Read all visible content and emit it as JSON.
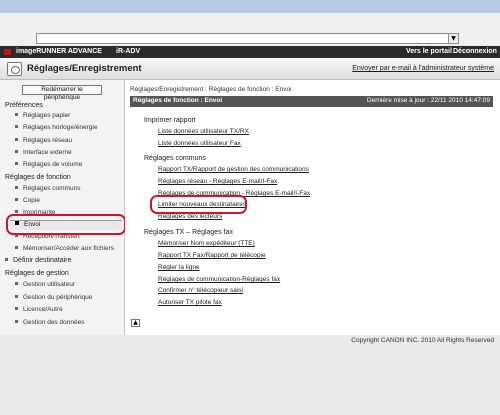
{
  "browser": {
    "address_dropdown": "▼"
  },
  "topbar": {
    "brand": "imageRUNNER ADVANCE",
    "model": "iR-ADV",
    "portal_link": "Vers le portail",
    "logout_link": "Déconnexion"
  },
  "titlebar": {
    "title": "Réglages/Enregistrement",
    "email_link": "Envoyer par e-mail à l'administrateur système"
  },
  "sidebar": {
    "restart_button": "Redémarrer le périphérique",
    "sections": [
      {
        "label": "Préférences",
        "items": [
          "Réglages papier",
          "Réglages horloge/énergie",
          "Réglages réseau",
          "Interface externe",
          "Réglages de volume"
        ]
      },
      {
        "label": "Réglages de fonction",
        "items": [
          "Réglages communs",
          "Copie",
          "Imprimante",
          "Envoi",
          "Réception/Transfert",
          "Mémoriser/Accéder aux fichiers"
        ]
      },
      {
        "label": "Définir destinataire",
        "items": []
      },
      {
        "label": "Réglages de gestion",
        "items": [
          "Gestion utilisateur",
          "Gestion du périphérique",
          "Licence/Autre",
          "Gestion des données"
        ]
      }
    ],
    "active_item": "Envoi"
  },
  "main": {
    "breadcrumb": "Réglages/Enregistrement : Réglages de fonction : Envoi",
    "header_title": "Réglages de fonction : Envoi",
    "last_update": "Dernière mise à jour : 22/11 2010 14:47:09",
    "groups": [
      {
        "title": "Imprimer rapport",
        "links": [
          "Liste données utilisateur TX/RX",
          "Liste données utilisateur Fax"
        ]
      },
      {
        "title": "Réglages communs",
        "links": [
          "Rapport TX/Rapport de gestion des communications",
          "Réglages réseau - Réglages E-mail/I-Fax",
          "Réglages de communication - Réglages E-mail/I-Fax",
          "Limiter nouveaux destinataires",
          "Réglages des lecteurs"
        ]
      },
      {
        "title": "Réglages TX – Réglages fax",
        "links": [
          "Mémoriser Nom expéditeur (TTE)",
          "Rapport TX Fax/Rapport de télécopie",
          "Régler la ligne",
          "Réglages de communication-Réglages fax",
          "Confirmer n° télécopieur saisi",
          "Autoriser TX pilote fax"
        ]
      }
    ],
    "top_button": "▲"
  },
  "footer": {
    "copyright": "Copyright CANON INC. 2010 All Rights Reserved"
  }
}
